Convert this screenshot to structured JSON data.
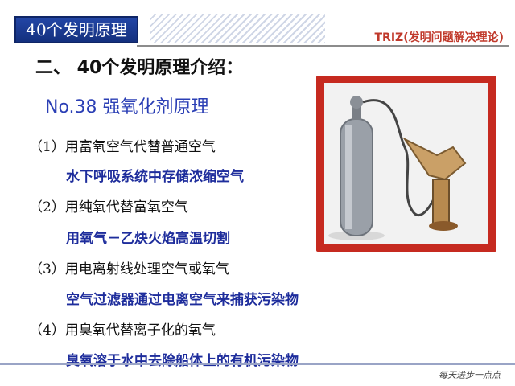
{
  "header": {
    "label": "40个发明原理",
    "subtitle": "TRIZ(发明问题解决理论)"
  },
  "section_title": "二、 40个发明原理介绍：",
  "principle_title": "No.38  强氧化剂原理",
  "items": [
    {
      "label": "（1）用富氧空气代替普通空气",
      "example": "水下呼吸系统中存储浓缩空气"
    },
    {
      "label": "（2）用纯氧代替富氧空气",
      "example": "用氧气－乙炔火焰高温切割"
    },
    {
      "label": "（3）用电离射线处理空气或氧气",
      "example": "空气过滤器通过电离空气来捕获污染物"
    },
    {
      "label": "（4）用臭氧代替离子化的氧气",
      "example": "臭氧溶于水中去除船体上的有机污染物"
    }
  ],
  "footer": "每天进步一点点",
  "colors": {
    "accent_blue": "#2b3fb5",
    "header_blue": "#1c3a94",
    "photo_red": "#c62a20",
    "triz_red": "#c0392b"
  }
}
